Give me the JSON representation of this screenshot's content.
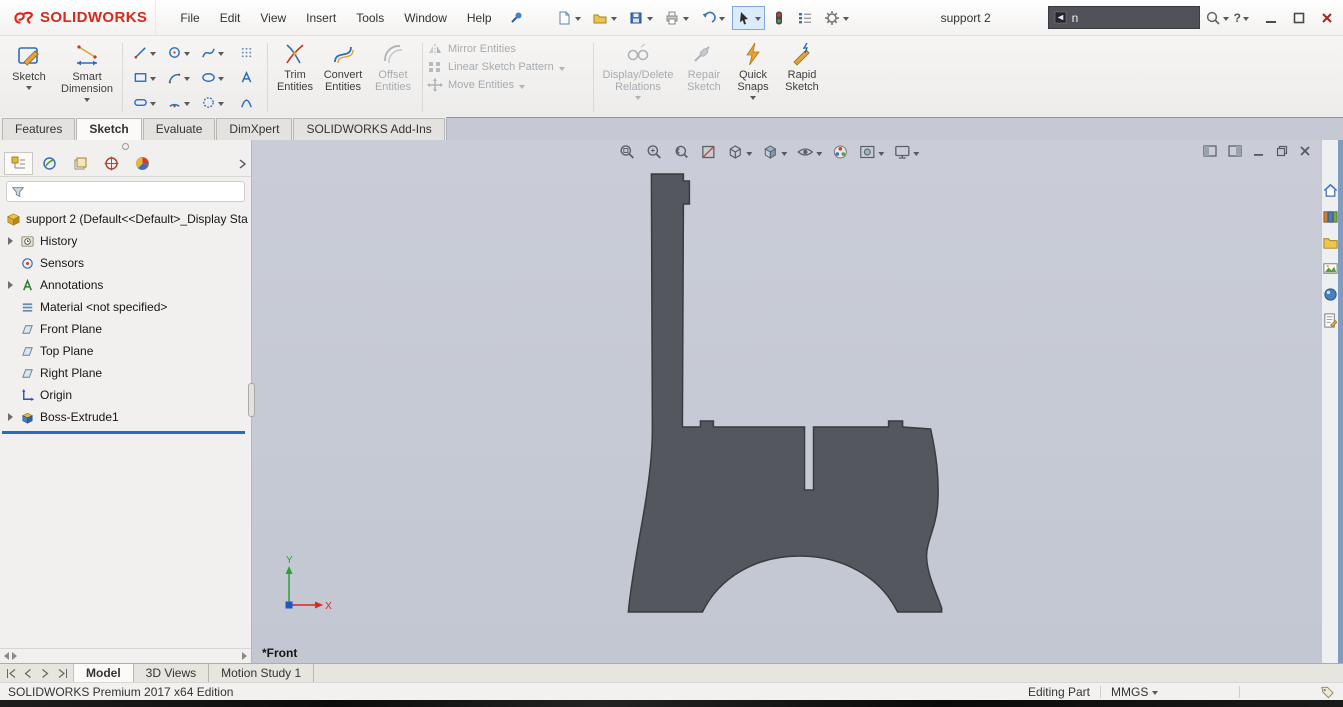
{
  "colors": {
    "brand_red": "#e2231a",
    "viewport_background": "#c5c9d3",
    "part_fill": "#54575e",
    "rollback_bar": "#2f67c5",
    "disabled_text": "#a7abb0"
  },
  "title_bar": {
    "logo_text": "SOLIDWORKS",
    "menus": [
      "File",
      "Edit",
      "View",
      "Insert",
      "Tools",
      "Window",
      "Help"
    ],
    "toolbar_icons": [
      "new-document",
      "open",
      "save",
      "print",
      "undo",
      "select",
      "interface-options",
      "command-list",
      "settings-gear"
    ],
    "document_title": "support 2",
    "search_value": "n",
    "help_label": "?"
  },
  "ribbon": {
    "sketch": "Sketch",
    "smart_dimension": "Smart Dimension",
    "trim": "Trim Entities",
    "convert": "Convert Entities",
    "offset": "Offset Entities",
    "mirror": "Mirror Entities",
    "linear_pattern": "Linear Sketch Pattern",
    "move": "Move Entities",
    "display_delete": "Display/Delete Relations",
    "repair": "Repair Sketch",
    "quick_snaps": "Quick Snaps",
    "rapid_sketch": "Rapid Sketch"
  },
  "command_tabs": [
    "Features",
    "Sketch",
    "Evaluate",
    "DimXpert",
    "SOLIDWORKS Add-Ins"
  ],
  "active_command_tab": "Sketch",
  "feature_tree": {
    "root_label": "support 2 (Default<<Default>_Display Sta",
    "items": [
      {
        "label": "History"
      },
      {
        "label": "Sensors"
      },
      {
        "label": "Annotations"
      },
      {
        "label": "Material <not specified>"
      },
      {
        "label": "Front Plane"
      },
      {
        "label": "Top Plane"
      },
      {
        "label": "Right Plane"
      },
      {
        "label": "Origin"
      },
      {
        "label": "Boss-Extrude1"
      }
    ]
  },
  "viewport": {
    "view_label": "*Front",
    "axis_x": "X",
    "axis_y": "Y",
    "hud_icons": [
      "zoom-fit",
      "zoom-to-area",
      "previous-view",
      "section-view",
      "view-orientation",
      "display-style",
      "hide-show-items",
      "edit-appearance",
      "apply-scene",
      "view-settings"
    ]
  },
  "taskpane_icons": [
    "home",
    "design-library",
    "file-explorer",
    "view-palette",
    "appearances",
    "custom-properties"
  ],
  "bottom_tabs": [
    "Model",
    "3D Views",
    "Motion Study 1"
  ],
  "status_bar": {
    "edition": "SOLIDWORKS Premium 2017 x64 Edition",
    "mode": "Editing Part",
    "units": "MMGS"
  }
}
